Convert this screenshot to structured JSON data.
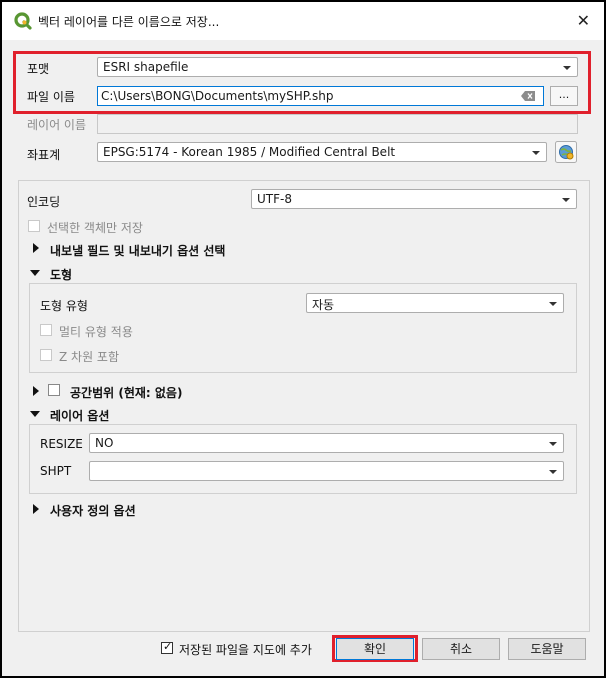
{
  "window": {
    "title": "벡터 레이어를 다른 이름으로 저장...",
    "close_glyph": "✕"
  },
  "top": {
    "format_label": "포맷",
    "format_value": "ESRI shapefile",
    "filename_label": "파일 이름",
    "filename_value": "C:\\Users\\BONG\\Documents\\mySHP.shp",
    "browse_label": "...",
    "layername_label": "레이어 이름",
    "layername_value": "",
    "crs_label": "좌표계",
    "crs_value": "EPSG:5174 - Korean 1985 / Modified Central Belt"
  },
  "options": {
    "encoding_label": "인코딩",
    "encoding_value": "UTF-8",
    "selected_only_label": "선택한 객체만 저장",
    "fields_section_label": "내보낼 필드 및 내보내기 옵션 선택",
    "geometry_section_label": "도형",
    "geometry_type_label": "도형 유형",
    "geometry_type_value": "자동",
    "multi_type_label": "멀티 유형 적용",
    "z_dim_label": "Z 차원 포함",
    "extent_label": "공간범위 (현재: 없음)",
    "layer_options_label": "레이어 옵션",
    "resize_label": "RESIZE",
    "resize_value": "NO",
    "shpt_label": "SHPT",
    "shpt_value": "",
    "custom_options_label": "사용자 정의 옵션"
  },
  "footer": {
    "add_to_map_label": "저장된 파일을 지도에 추가",
    "add_to_map_checked": true,
    "ok_label": "확인",
    "cancel_label": "취소",
    "help_label": "도움말"
  },
  "colors": {
    "highlight": "#e0202c",
    "qgis_green": "#589632",
    "qgis_yellow": "#f0b429"
  }
}
